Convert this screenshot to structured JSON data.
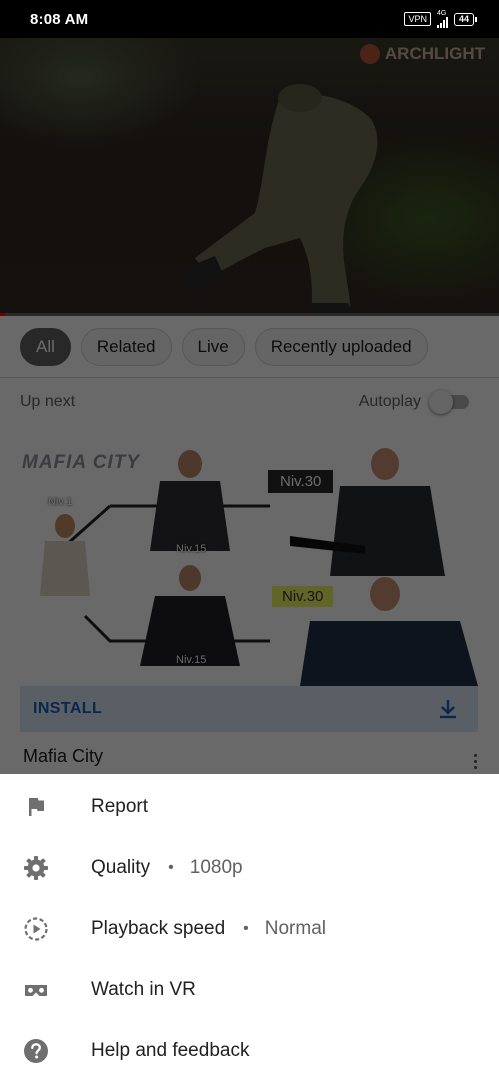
{
  "status_bar": {
    "time": "8:08 AM",
    "vpn": "VPN",
    "network": "4G",
    "battery": "44"
  },
  "video": {
    "watermark": "ARCHLIGHT",
    "progress_fraction": 0.01
  },
  "filter_chips": [
    {
      "label": "All",
      "selected": true
    },
    {
      "label": "Related",
      "selected": false
    },
    {
      "label": "Live",
      "selected": false
    },
    {
      "label": "Recently uploaded",
      "selected": false
    }
  ],
  "up_next": {
    "label": "Up next",
    "autoplay_label": "Autoplay",
    "autoplay_on": false
  },
  "ad": {
    "brand": "MAFIA CITY",
    "levels": [
      "Niv.1",
      "Niv.15",
      "Niv.30",
      "Niv.15",
      "Niv.30"
    ],
    "install_label": "INSTALL",
    "title": "Mafia City"
  },
  "menu": {
    "items": [
      {
        "icon": "flag-icon",
        "label": "Report",
        "value": ""
      },
      {
        "icon": "gear-icon",
        "label": "Quality",
        "value": "1080p"
      },
      {
        "icon": "playback-speed-icon",
        "label": "Playback speed",
        "value": "Normal"
      },
      {
        "icon": "vr-headset-icon",
        "label": "Watch in VR",
        "value": ""
      },
      {
        "icon": "help-icon",
        "label": "Help and feedback",
        "value": ""
      }
    ],
    "separator": "•"
  },
  "colors": {
    "accent_red": "#ff0000",
    "install_blue": "#1a5fb4",
    "icon_gray": "#6f6f6f"
  }
}
